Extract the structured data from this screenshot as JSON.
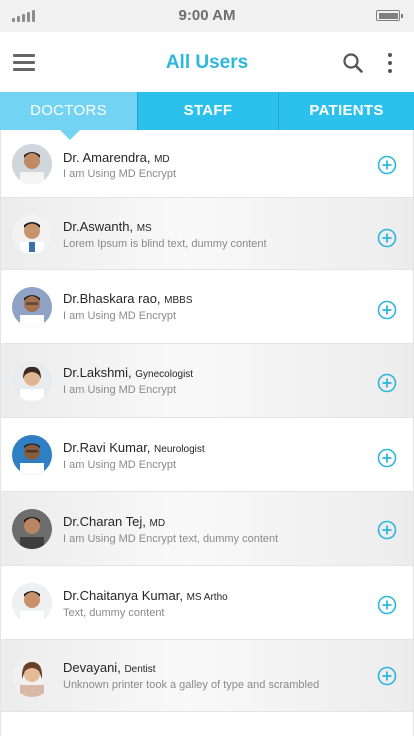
{
  "status_bar": {
    "time": "9:00 AM"
  },
  "header": {
    "title": "All Users"
  },
  "tabs": [
    {
      "label": "DOCTORS",
      "active": true
    },
    {
      "label": "STAFF",
      "active": false
    },
    {
      "label": "PATIENTS",
      "active": false
    }
  ],
  "colors": {
    "accent": "#2cb7dc",
    "tab_bar": "#2bc1ec",
    "tab_active": "#72d3f2"
  },
  "icons": {
    "menu": "hamburger-icon",
    "search": "search-icon",
    "more": "more-vertical-icon",
    "add": "plus-circle-icon"
  },
  "users": [
    {
      "name": "Dr. Amarendra,",
      "qualification": "MD",
      "status": "I am Using MD Encrypt"
    },
    {
      "name": "Dr.Aswanth,",
      "qualification": "MS",
      "status": "Lorem Ipsum is blind text, dummy content"
    },
    {
      "name": "Dr.Bhaskara rao,",
      "qualification": "MBBS",
      "status": "I am Using MD Encrypt"
    },
    {
      "name": "Dr.Lakshmi,",
      "qualification": "Gynecologist",
      "status": "I am Using MD Encrypt"
    },
    {
      "name": "Dr.Ravi Kumar,",
      "qualification": "Neurologist",
      "status": "I am Using MD Encrypt"
    },
    {
      "name": "Dr.Charan Tej,",
      "qualification": "MD",
      "status": "I am Using MD Encrypt text, dummy content"
    },
    {
      "name": "Dr.Chaitanya Kumar,",
      "qualification": "MS Artho",
      "status": "Text, dummy content"
    },
    {
      "name": "Devayani,",
      "qualification": "Dentist",
      "status": "Unknown printer took a galley of type and scrambled"
    }
  ]
}
